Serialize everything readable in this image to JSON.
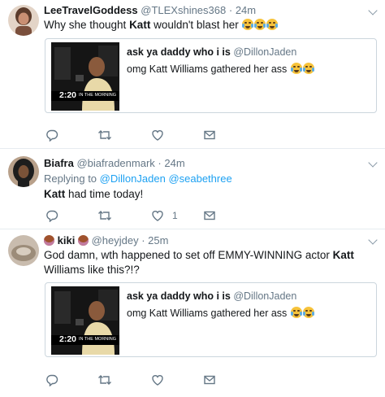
{
  "tweets": [
    {
      "name": "LeeTravelGoddess",
      "handle": "@TLEXshines368",
      "separator": "·",
      "time": "24m",
      "text_pre": "Why she thought ",
      "text_bold": "Katt",
      "text_post": " wouldn't blast her",
      "emoji_count": 3,
      "avatar_colors": [
        "#c79a86",
        "#6b4534"
      ],
      "quote": {
        "name": "ask ya daddy who i is",
        "handle": "@DillonJaden",
        "text": "omg Katt Williams gathered her ass",
        "video_time": "2:20",
        "video_caption": "IN THE MORNING"
      },
      "like_count": ""
    },
    {
      "name": "Biafra",
      "handle": "@biafradenmark",
      "separator": "·",
      "time": "24m",
      "reply_prefix": "Replying to",
      "reply_users": [
        "@DillonJaden",
        "@seabethree"
      ],
      "text_bold": "Katt",
      "text_post": " had time today!",
      "avatar_colors": [
        "#2a2a2a",
        "#8d6b4f"
      ],
      "like_count": "1"
    },
    {
      "name": "kiki",
      "handle": "@heyjdey",
      "separator": "·",
      "time": "25m",
      "text_pre": "God damn, wth happened to set off EMMY-WINNING actor ",
      "text_bold": "Katt",
      "text_post": " Williams like this?!?",
      "avatar_colors": [
        "#b9aa98",
        "#8a7a68"
      ],
      "quote": {
        "name": "ask ya daddy who i is",
        "handle": "@DillonJaden",
        "text": "omg Katt Williams gathered her ass",
        "video_time": "2:20",
        "video_caption": "IN THE MORNING"
      },
      "like_count": ""
    }
  ],
  "icons": {
    "reply": "reply-icon",
    "retweet": "retweet-icon",
    "like": "heart-icon",
    "dm": "envelope-icon",
    "more": "chevron-down-icon"
  },
  "colors": {
    "link": "#1da1f2",
    "secondary": "#657786",
    "border": "#e6ecf0"
  }
}
